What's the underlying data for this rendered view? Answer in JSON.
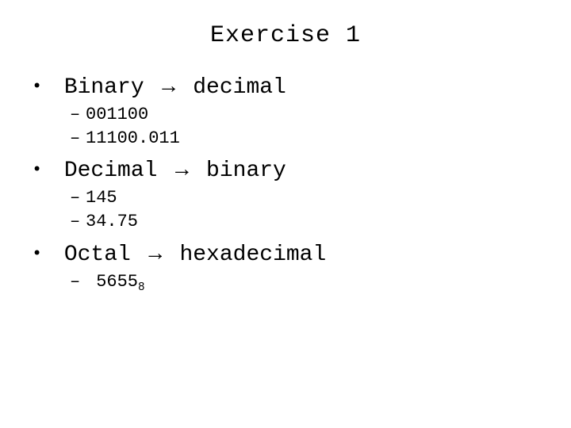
{
  "title": "Exercise 1",
  "sections": [
    {
      "heading_pre": "Binary ",
      "heading_post": " decimal",
      "items": [
        "001100",
        "11100.011"
      ]
    },
    {
      "heading_pre": "Decimal ",
      "heading_post": " binary",
      "items": [
        "145",
        "34.75"
      ]
    },
    {
      "heading_pre": "Octal ",
      "heading_post": " hexadecimal",
      "items_rich": [
        {
          "text": "5655",
          "sub": "8"
        }
      ]
    }
  ],
  "arrow_glyph": "→"
}
